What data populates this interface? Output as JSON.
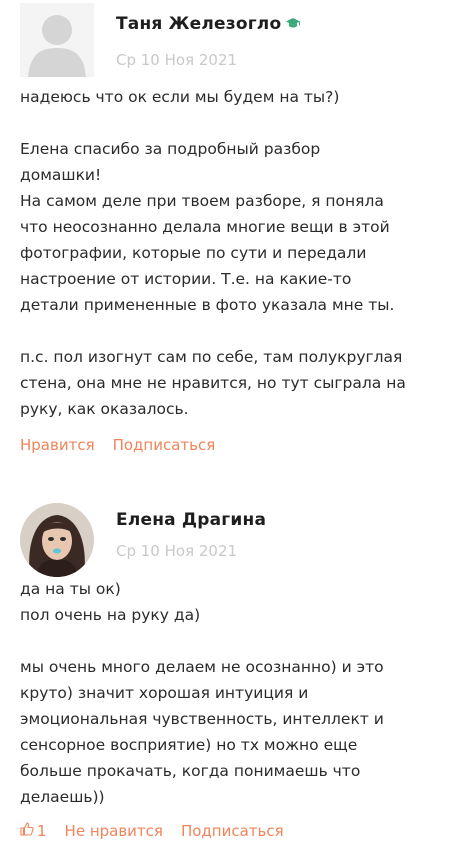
{
  "comments": [
    {
      "author": "Таня Железогло",
      "date": "Ср 10 Ноя 2021",
      "icons": {
        "avatar": "avatar-placeholder-icon",
        "badge": "graduation-cap-icon"
      },
      "paragraphs": [
        [
          "надеюсь что ок если мы будем на ты?)"
        ],
        [
          "Елена спасибо за подробный разбор",
          "домашки!",
          "На самом деле при твоем разборе, я поняла",
          "что неосознанно делала многие вещи в этой",
          "фотографии, которые по сути и передали",
          "настроение от истории. Т.е. на какие-то",
          "детали примененные в фото указала мне ты."
        ],
        [
          "п.с. пол изогнут сам по себе, там полукруглая",
          "стена, она мне не нравится, но тут сыграла на",
          "руку, как оказалось."
        ]
      ],
      "actions": {
        "like": "Нравится",
        "subscribe": "Подписаться"
      }
    },
    {
      "author": "Елена Драгина",
      "date": "Ср 10 Ноя 2021",
      "icons": {
        "avatar": "user-avatar-photo"
      },
      "paragraphs": [
        [
          "да на ты ок)",
          "пол очень на руку да)"
        ],
        [
          "мы очень много делаем не осознанно) и это",
          "круто) значит хорошая интуиция и",
          "эмоциональная чувственность, интеллект и",
          "сенсорное восприятие) но тх можно еще",
          "больше прокачать, когда понимаешь что",
          "делаешь))"
        ]
      ],
      "actions": {
        "like_count": "1",
        "like_icon": "thumbs-up-icon",
        "dislike": "Не нравится",
        "subscribe": "Подписаться"
      }
    }
  ],
  "colors": {
    "accent": "#f0845a",
    "date": "#c9c9c9",
    "badge": "#3aaa7a",
    "text": "#2b2b2b"
  }
}
